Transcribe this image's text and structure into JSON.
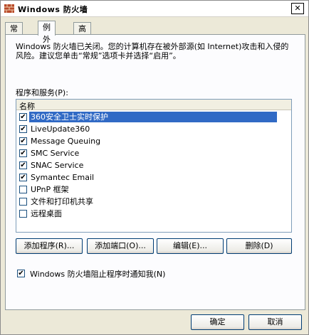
{
  "window": {
    "title": "Windows 防火墙",
    "close_glyph": "✕"
  },
  "tabs": [
    {
      "label": "常规"
    },
    {
      "label": "例外"
    },
    {
      "label": "高级"
    }
  ],
  "info_text": "Windows 防火墙已关闭。您的计算机存在被外部源(如 Internet)攻击和入侵的风险。建议您单击“常规”选项卡并选择“启用”。",
  "list": {
    "label": "程序和服务(P):",
    "column_header": "名称",
    "items": [
      {
        "label": "360安全卫士实时保护",
        "checked": true,
        "selected": true
      },
      {
        "label": "LiveUpdate360",
        "checked": true
      },
      {
        "label": "Message Queuing",
        "checked": true
      },
      {
        "label": "SMC Service",
        "checked": true
      },
      {
        "label": "SNAC Service",
        "checked": true
      },
      {
        "label": "Symantec Email",
        "checked": true
      },
      {
        "label": "UPnP 框架",
        "checked": false
      },
      {
        "label": "文件和打印机共享",
        "checked": false
      },
      {
        "label": "远程桌面",
        "checked": false
      }
    ]
  },
  "buttons": {
    "add_program": "添加程序(R)...",
    "add_port": "添加端口(O)...",
    "edit": "编辑(E)...",
    "delete": "删除(D)"
  },
  "notify": {
    "label": "Windows 防火墙阻止程序时通知我(N)",
    "checked": true
  },
  "footer": {
    "ok": "确定",
    "cancel": "取消"
  },
  "colors": {
    "selection": "#316ac5",
    "dialog_bg": "#ece9d8"
  }
}
